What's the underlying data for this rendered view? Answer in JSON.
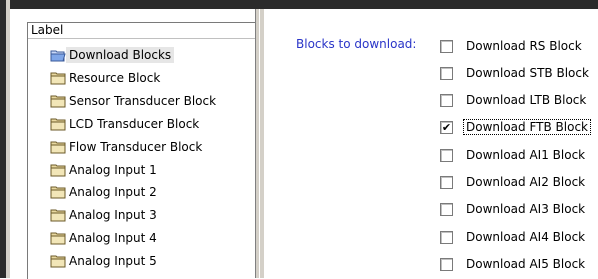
{
  "tree": {
    "header": "Label",
    "items": [
      {
        "label": "Download Blocks",
        "selected": true
      },
      {
        "label": "Resource Block"
      },
      {
        "label": "Sensor Transducer Block"
      },
      {
        "label": "LCD Transducer Block"
      },
      {
        "label": "Flow Transducer Block"
      },
      {
        "label": "Analog Input 1"
      },
      {
        "label": "Analog Input 2"
      },
      {
        "label": "Analog Input 3"
      },
      {
        "label": "Analog Input 4"
      },
      {
        "label": "Analog Input 5"
      }
    ]
  },
  "options": {
    "blocks_label": "Blocks to download:",
    "checkboxes": [
      {
        "label": "Download RS Block",
        "checked": false
      },
      {
        "label": "Download STB Block",
        "checked": false
      },
      {
        "label": "Download LTB Block",
        "checked": false
      },
      {
        "label": "Download FTB Block",
        "checked": true,
        "focused": true
      },
      {
        "label": "Download AI1 Block",
        "checked": false
      },
      {
        "label": "Download AI2 Block",
        "checked": false
      },
      {
        "label": "Download AI3 Block",
        "checked": false
      },
      {
        "label": "Download AI4 Block",
        "checked": false
      },
      {
        "label": "Download AI5 Block",
        "checked": false
      }
    ],
    "check_glyph": "✔"
  },
  "colors": {
    "label_blue": "#2a35c8",
    "folder": "#e8d8a0",
    "folder_open": "#7fa6e8"
  }
}
